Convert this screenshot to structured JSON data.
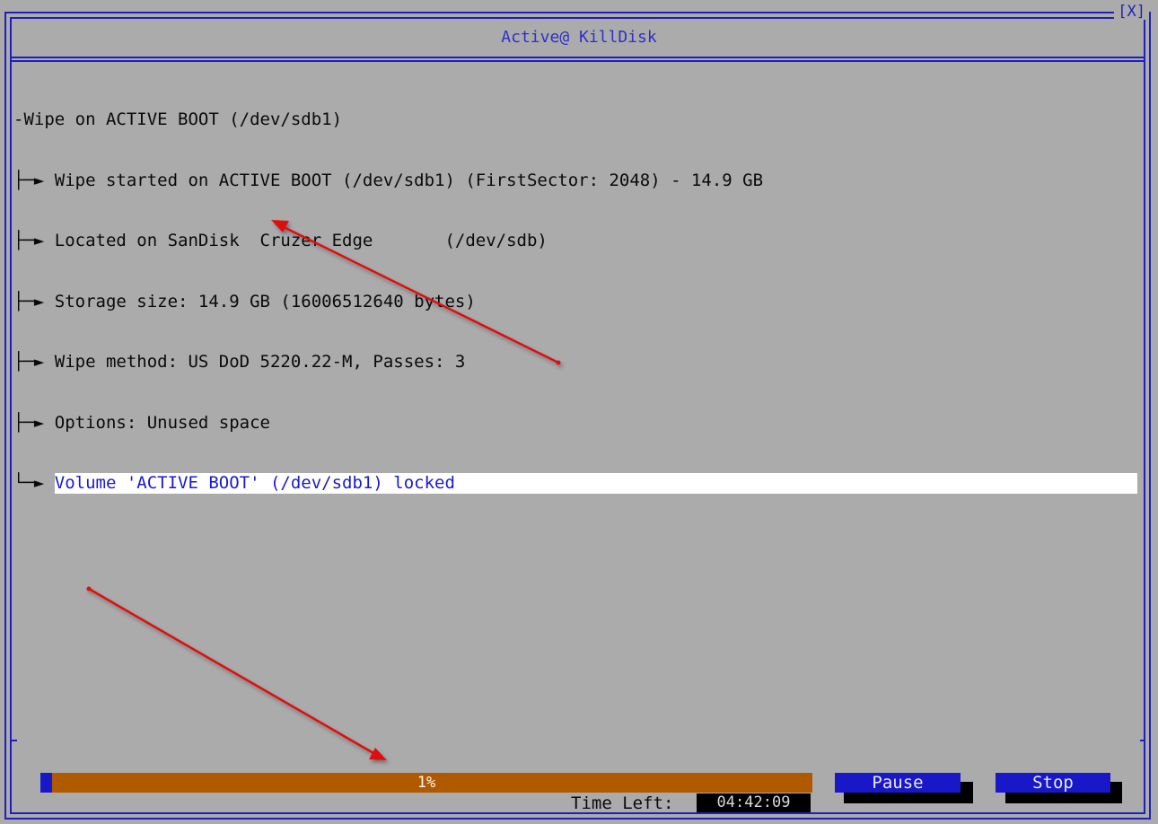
{
  "window": {
    "title": "Active@ KillDisk",
    "close_label": "[X]"
  },
  "log": {
    "root": "Wipe on ACTIVE BOOT (/dev/sdb1)",
    "items": [
      "Wipe started on ACTIVE BOOT (/dev/sdb1) (FirstSector: 2048) - 14.9 GB",
      "Located on SanDisk  Cruzer Edge       (/dev/sdb)",
      "Storage size: 14.9 GB (16006512640 bytes)",
      "Wipe method: US DoD 5220.22-M, Passes: 3",
      "Options: Unused space",
      "Volume 'ACTIVE BOOT' (/dev/sdb1) locked"
    ],
    "selected_index": 5
  },
  "progress": {
    "percent_label": "1%",
    "fraction": 0.015
  },
  "time_left": {
    "label": "Time Left:",
    "value": "04:42:09"
  },
  "buttons": {
    "pause": "Pause",
    "stop": "Stop"
  },
  "colors": {
    "background": "#ababab",
    "frame": "#1f1fbf",
    "progress_track": "#b05a00",
    "progress_fill": "#1818c8",
    "button": "#1818c8",
    "annotation_arrow": "#e01010"
  }
}
